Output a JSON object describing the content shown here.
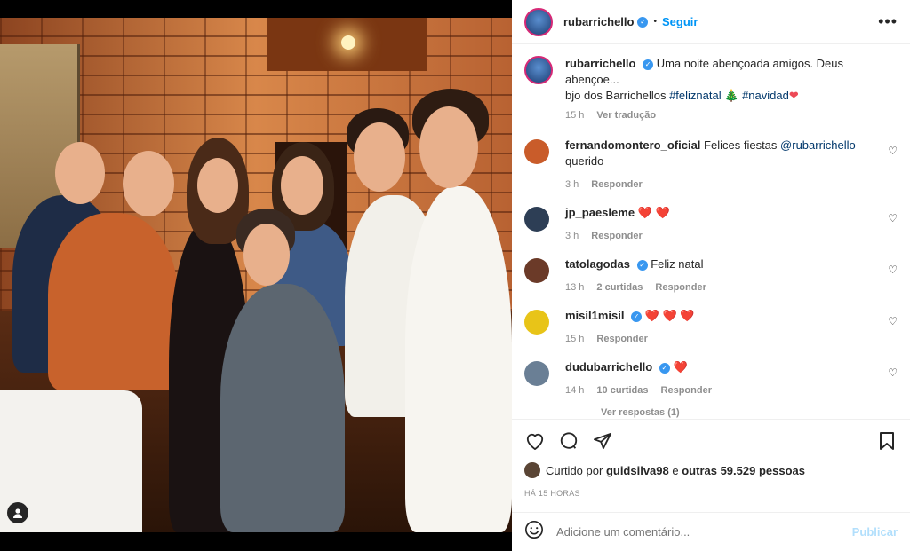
{
  "post_header": {
    "username": "rubarrichello",
    "follow_label": "Seguir",
    "dot": "•",
    "more_label": "•••"
  },
  "caption": {
    "username": "rubarrichello",
    "text": "Uma noite abençoada amigos. Deus abençoe...",
    "text2": "bjo dos Barrichellos",
    "hashtag1": "#feliznatal",
    "tree": "🎄",
    "hashtag2": "#navidad",
    "heart": "❤",
    "time": "15 h",
    "translate": "Ver tradução"
  },
  "comments": [
    {
      "user": "fernandomontero_oficial",
      "prefix": "Felices fiestas",
      "mention": "@rubarrichello",
      "suffix": "querido",
      "time": "3 h",
      "reply": "Responder",
      "avatar_color": "#c95c2a"
    },
    {
      "user": "jp_paesleme",
      "text": "❤️ ❤️",
      "time": "3 h",
      "reply": "Responder",
      "avatar_color": "#2d3e55"
    },
    {
      "user": "tatolagodas",
      "text": "Feliz natal",
      "time": "13 h",
      "likes": "2 curtidas",
      "reply": "Responder",
      "avatar_color": "#6b3a28"
    },
    {
      "user": "misil1misil",
      "text": "❤️ ❤️ ❤️",
      "time": "15 h",
      "reply": "Responder",
      "avatar_color": "#e8c418"
    },
    {
      "user": "dudubarrichello",
      "text": "❤️",
      "time": "14 h",
      "likes": "10 curtidas",
      "reply": "Responder",
      "avatar_color": "#6a7f95"
    }
  ],
  "view_replies": "Ver respostas (1)",
  "likes": {
    "prefix": "Curtido por",
    "user": "guidsilva98",
    "middle": "e",
    "others": "outras 59.529 pessoas"
  },
  "time_ago": "HÁ 15 HORAS",
  "add_comment": {
    "placeholder": "Adicione um comentário...",
    "publish": "Publicar"
  }
}
